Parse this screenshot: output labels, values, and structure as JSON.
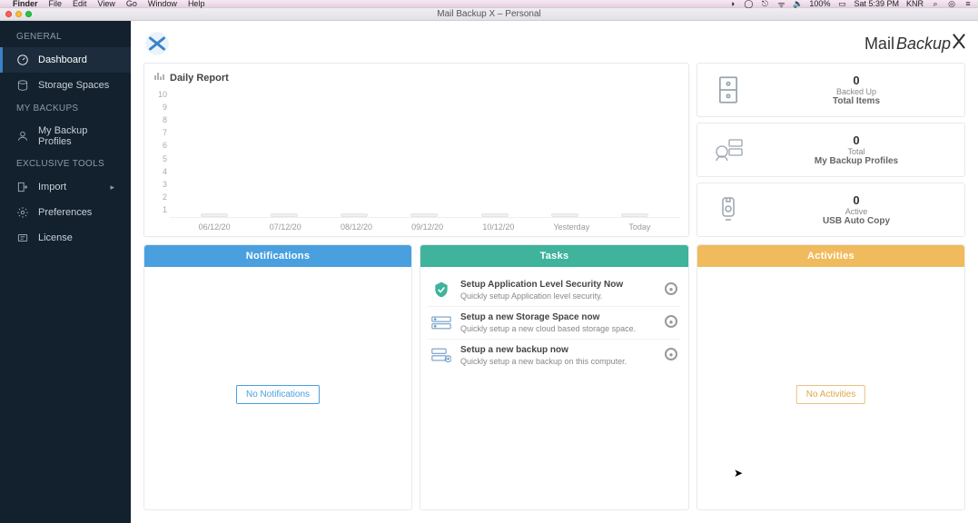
{
  "menubar": {
    "app": "Finder",
    "items": [
      "File",
      "Edit",
      "View",
      "Go",
      "Window",
      "Help"
    ],
    "battery": "100%",
    "clock": "Sat 5:39 PM",
    "user": "KNR"
  },
  "window": {
    "title": "Mail Backup X – Personal"
  },
  "brand": {
    "part1": "Mail",
    "part2": "Backup"
  },
  "sidebar": {
    "sections": [
      {
        "title": "GENERAL",
        "items": [
          {
            "icon": "gauge",
            "label": "Dashboard",
            "active": true
          },
          {
            "icon": "disk",
            "label": "Storage Spaces"
          }
        ]
      },
      {
        "title": "MY BACKUPS",
        "items": [
          {
            "icon": "user",
            "label": "My Backup Profiles"
          }
        ]
      },
      {
        "title": "EXCLUSIVE TOOLS",
        "items": [
          {
            "icon": "import",
            "label": "Import",
            "sub": true
          },
          {
            "icon": "gear",
            "label": "Preferences"
          },
          {
            "icon": "license",
            "label": "License"
          }
        ]
      }
    ]
  },
  "daily_title": "Daily Report",
  "chart_data": {
    "type": "bar",
    "categories": [
      "06/12/20",
      "07/12/20",
      "08/12/20",
      "09/12/20",
      "10/12/20",
      "Yesterday",
      "Today"
    ],
    "values": [
      0,
      0,
      0,
      0,
      0,
      0,
      0
    ],
    "yticks": [
      10,
      9,
      8,
      7,
      6,
      5,
      4,
      3,
      2,
      1
    ],
    "title": "Daily Report",
    "xlabel": "",
    "ylabel": "",
    "ylim": [
      0,
      10
    ]
  },
  "stats": [
    {
      "value": "0",
      "line1": "Backed Up",
      "line2": "Total Items"
    },
    {
      "value": "0",
      "line1": "Total",
      "line2": "My Backup Profiles"
    },
    {
      "value": "0",
      "line1": "Active",
      "line2": "USB Auto Copy"
    }
  ],
  "columns": {
    "notifications": {
      "title": "Notifications",
      "empty": "No Notifications"
    },
    "tasks": {
      "title": "Tasks",
      "items": [
        {
          "title": "Setup Application Level Security Now",
          "sub": "Quickly setup Application level security."
        },
        {
          "title": "Setup a new Storage Space now",
          "sub": "Quickly setup a new cloud based storage space."
        },
        {
          "title": "Setup a new backup now",
          "sub": "Quickly setup a new backup on this computer."
        }
      ]
    },
    "activities": {
      "title": "Activities",
      "empty": "No Activities"
    }
  }
}
